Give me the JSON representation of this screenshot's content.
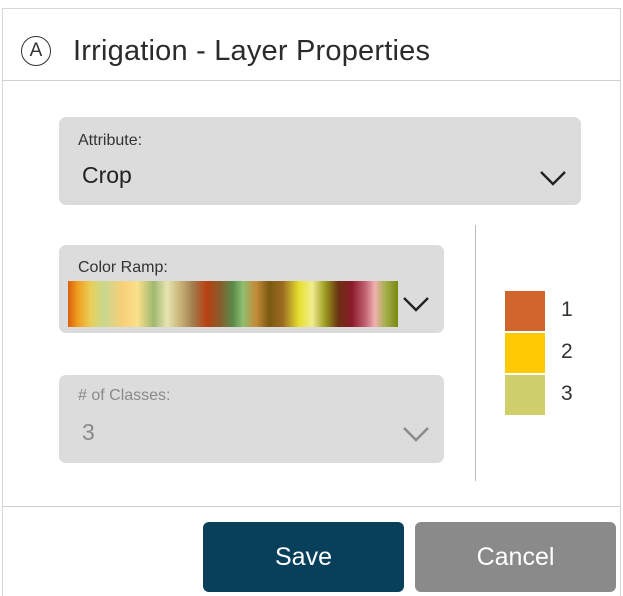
{
  "dialog": {
    "layer_icon_letter": "A",
    "title": "Irrigation - Layer Properties"
  },
  "attribute": {
    "label": "Attribute:",
    "value": "Crop"
  },
  "color_ramp": {
    "label": "Color Ramp:"
  },
  "classes": {
    "label": "# of Classes:",
    "value": "3",
    "disabled": true
  },
  "legend": {
    "items": [
      {
        "label": "1",
        "color": "#d2642e"
      },
      {
        "label": "2",
        "color": "#ffc904"
      },
      {
        "label": "3",
        "color": "#cfcf6c"
      }
    ]
  },
  "buttons": {
    "save_label": "Save",
    "cancel_label": "Cancel"
  },
  "colors": {
    "save_button": "#083f5a",
    "cancel_button": "#8a8a8a",
    "field_background": "#dcdcdc"
  }
}
